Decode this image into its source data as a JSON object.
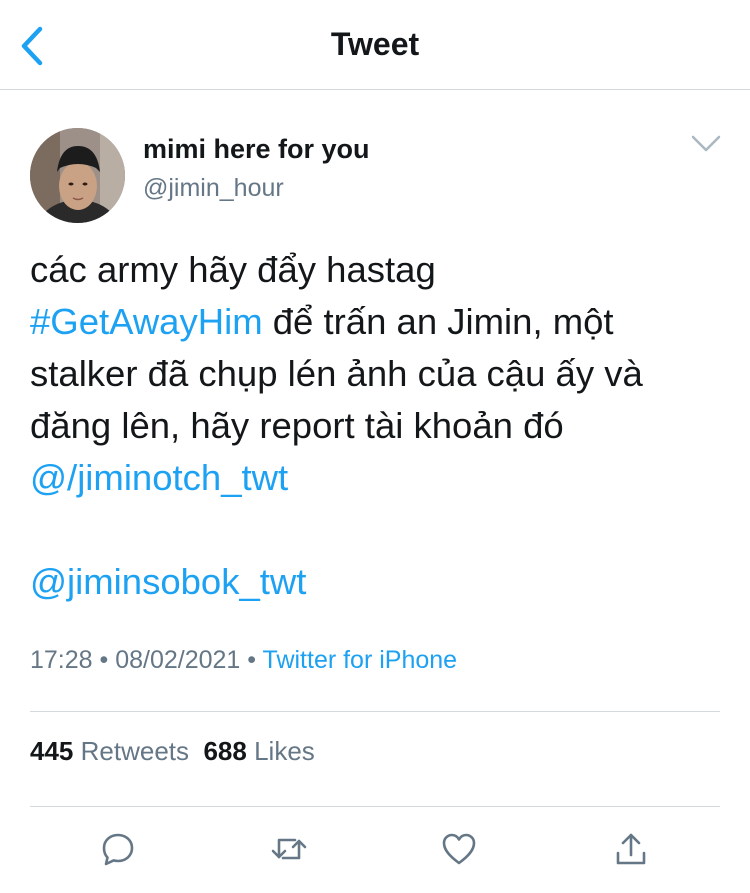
{
  "nav": {
    "title": "Tweet",
    "back_icon": "chevron-left-icon"
  },
  "author": {
    "display_name": "mimi here for you",
    "handle": "@jimin_hour"
  },
  "tweet": {
    "line1": "các army hãy đẩy hastag",
    "hashtag": "#GetAwayHim",
    "line2_rest": " để trấn an Jimin, một",
    "line3": "stalker đã chụp lén ảnh của cậu ấy và",
    "line4": "đăng lên, hãy report tài khoản đó",
    "mention1": "@/jiminotch_twt",
    "mention2": "@jiminsobok_twt"
  },
  "meta": {
    "time": "17:28",
    "separator": " • ",
    "date": "08/02/2021",
    "source": "Twitter for iPhone"
  },
  "stats": {
    "retweets_count": "445",
    "retweets_label": "Retweets",
    "likes_count": "688",
    "likes_label": "Likes"
  },
  "actions": {
    "reply_icon": "reply-icon",
    "retweet_icon": "retweet-icon",
    "like_icon": "heart-icon",
    "share_icon": "share-icon"
  },
  "colors": {
    "accent": "#1da1f2",
    "text": "#14171a",
    "secondary": "#657786",
    "divider": "#d5d9dc"
  }
}
